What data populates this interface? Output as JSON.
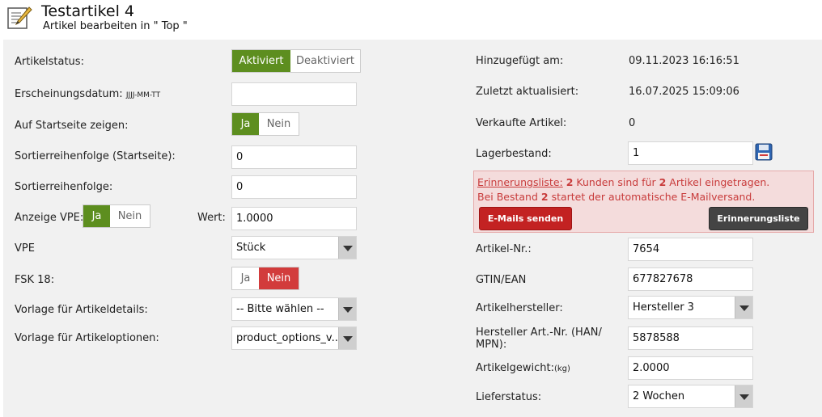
{
  "header": {
    "title": "Testartikel 4",
    "subtitle": "Artikel bearbeiten in \" Top \""
  },
  "left": {
    "status_label": "Artikelstatus:",
    "status_active": "Aktiviert",
    "status_inactive": "Deaktiviert",
    "date_label": "Erscheinungsdatum:",
    "date_hint": "JJJJ-MM-TT",
    "date_value": "",
    "startpage_label": "Auf Startseite zeigen:",
    "yes": "Ja",
    "no": "Nein",
    "sort_start_label": "Sortierreihenfolge (Startseite):",
    "sort_start_value": "0",
    "sort_label": "Sortierreihenfolge:",
    "sort_value": "0",
    "vpe_show_label": "Anzeige VPE:",
    "wert_label": "Wert:",
    "wert_value": "1.0000",
    "vpe_label": "VPE",
    "vpe_value": "Stück",
    "fsk_label": "FSK 18:",
    "tmpl_details_label": "Vorlage für Artikeldetails:",
    "tmpl_details_value": "-- Bitte wählen --",
    "tmpl_options_label": "Vorlage für Artikeloptionen:",
    "tmpl_options_value": "product_options_v..."
  },
  "right": {
    "added_label": "Hinzugefügt am:",
    "added_value": "09.11.2023 16:16:51",
    "updated_label": "Zuletzt aktualisiert:",
    "updated_value": "16.07.2025 15:09:06",
    "sold_label": "Verkaufte Artikel:",
    "sold_value": "0",
    "stock_label": "Lagerbestand:",
    "stock_value": "1",
    "alert": {
      "link": "Erinnerungsliste:",
      "num1": "2",
      "text1": " Kunden sind für ",
      "num2": "2",
      "text2": " Artikel eingetragen.",
      "text3": "Bei Bestand ",
      "num3": "2",
      "text4": " startet der automatische E-Mailversand.",
      "send_button": "E-Mails senden",
      "list_button": "Erinnerungsliste"
    },
    "artnr_label": "Artikel-Nr.:",
    "artnr_value": "7654",
    "gtin_label": "GTIN/EAN",
    "gtin_value": "677827678",
    "manufacturer_label": "Artikelhersteller:",
    "manufacturer_value": "Hersteller 3",
    "mpn_label_1": "Hersteller Art.-Nr. (HAN/",
    "mpn_label_2": "MPN):",
    "mpn_value": "5878588",
    "weight_label": "Artikelgewicht:",
    "weight_unit": "(kg)",
    "weight_value": "2.0000",
    "delivery_label": "Lieferstatus:",
    "delivery_value": "2 Wochen"
  }
}
